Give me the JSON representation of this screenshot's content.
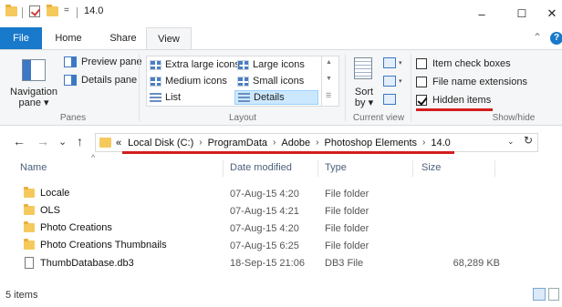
{
  "window": {
    "title": "14.0",
    "minimize": "–",
    "maximize": "☐",
    "close": "✕",
    "qat_dropdown": "="
  },
  "ribbon_tabs": {
    "file": "File",
    "home": "Home",
    "share": "Share",
    "view": "View",
    "collapse": "⌃",
    "help": "?"
  },
  "ribbon": {
    "panes": {
      "navigation_pane": "Navigation\npane ▾",
      "preview_pane": "Preview pane",
      "details_pane": "Details pane",
      "group": "Panes"
    },
    "layout": {
      "extra_large_icons": "Extra large icons",
      "large_icons": "Large icons",
      "medium_icons": "Medium icons",
      "small_icons": "Small icons",
      "list": "List",
      "details": "Details",
      "group": "Layout"
    },
    "current_view": {
      "sort_by": "Sort\nby ▾",
      "group": "Current view"
    },
    "show_hide": {
      "item_check_boxes": "Item check boxes",
      "file_name_extensions": "File name extensions",
      "hidden_items": "Hidden items",
      "hidden_items_checked": true,
      "group": "Show/hide"
    }
  },
  "address": {
    "back": "←",
    "forward": "→",
    "recent": "⌄",
    "up": "↑",
    "overflow": "«",
    "crumbs": [
      "Local Disk (C:)",
      "ProgramData",
      "Adobe",
      "Photoshop Elements",
      "14.0"
    ],
    "separator": "›",
    "dropdown": "⌄",
    "refresh": "↻"
  },
  "columns": {
    "name": "Name",
    "date_modified": "Date modified",
    "type": "Type",
    "size": "Size",
    "sort_indicator": "^"
  },
  "files": [
    {
      "name": "Locale",
      "date": "07-Aug-15 4:20",
      "type": "File folder",
      "size": "",
      "kind": "folder"
    },
    {
      "name": "OLS",
      "date": "07-Aug-15 4:21",
      "type": "File folder",
      "size": "",
      "kind": "folder"
    },
    {
      "name": "Photo Creations",
      "date": "07-Aug-15 4:20",
      "type": "File folder",
      "size": "",
      "kind": "folder"
    },
    {
      "name": "Photo Creations Thumbnails",
      "date": "07-Aug-15 6:25",
      "type": "File folder",
      "size": "",
      "kind": "folder"
    },
    {
      "name": "ThumbDatabase.db3",
      "date": "18-Sep-15 21:06",
      "type": "DB3 File",
      "size": "68,289 KB",
      "kind": "file"
    }
  ],
  "status": {
    "item_count": "5 items"
  },
  "colors": {
    "accent": "#1979ca",
    "highlight_underline": "#d21e1e",
    "folder": "#f5c95c"
  }
}
